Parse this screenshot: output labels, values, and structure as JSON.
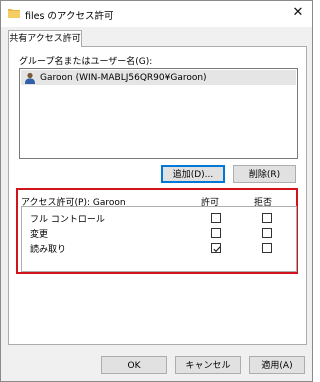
{
  "window": {
    "title": "files のアクセス許可",
    "close_glyph": "✕"
  },
  "tab": {
    "label": "共有アクセス許可"
  },
  "group_section": {
    "label": "グループ名またはユーザー名(G):",
    "users": [
      "Garoon (WIN-MABLJ56QR90¥Garoon)"
    ],
    "selected_index": 0,
    "add_button": "追加(D)...",
    "remove_button": "削除(R)"
  },
  "permissions": {
    "header_label": "アクセス許可(P): Garoon",
    "allow_header": "許可",
    "deny_header": "拒否",
    "rows": [
      {
        "label": "フル コントロール",
        "allow": false,
        "deny": false
      },
      {
        "label": "変更",
        "allow": false,
        "deny": false
      },
      {
        "label": "読み取り",
        "allow": true,
        "deny": false
      }
    ]
  },
  "footer": {
    "ok_button": "OK",
    "cancel_button": "キャンセル",
    "apply_button": "適用(A)"
  },
  "colors": {
    "highlight_border": "#d0141e",
    "focus_border": "#0078d7",
    "folder": "#e8b84a"
  },
  "icons": {
    "folder": "folder-icon",
    "user": "user-icon",
    "close": "close-icon",
    "check": "checkmark-icon"
  }
}
